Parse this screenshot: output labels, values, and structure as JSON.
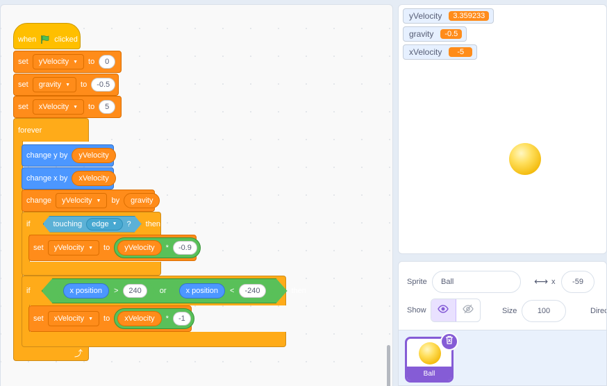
{
  "script": {
    "hat": {
      "when": "when",
      "clicked": "clicked"
    },
    "set1": {
      "kw": "set",
      "var": "yVelocity",
      "to": "to",
      "value": "0"
    },
    "set2": {
      "kw": "set",
      "var": "gravity",
      "to": "to",
      "value": "-0.5"
    },
    "set3": {
      "kw": "set",
      "var": "xVelocity",
      "to": "to",
      "value": "5"
    },
    "forever": "forever",
    "changeY": {
      "label": "change y by",
      "reporter": "yVelocity"
    },
    "changeX": {
      "label": "change x by",
      "reporter": "xVelocity"
    },
    "changeVar": {
      "kw": "change",
      "var": "yVelocity",
      "by": "by",
      "reporter": "gravity"
    },
    "if1": {
      "kw": "if",
      "touching": "touching",
      "target": "edge",
      "q": "?",
      "then": "then"
    },
    "setInner1": {
      "kw": "set",
      "var": "yVelocity",
      "to": "to",
      "reporter": "yVelocity",
      "op": "*",
      "value": "-0.9"
    },
    "if2": {
      "kw": "if",
      "left_reporter": "x position",
      "gt": ">",
      "left_value": "240",
      "or": "or",
      "right_reporter": "x position",
      "lt": "<",
      "right_value": "-240",
      "then": "then"
    },
    "setInner2": {
      "kw": "set",
      "var": "xVelocity",
      "to": "to",
      "reporter": "xVelocity",
      "op": "*",
      "value": "-1"
    }
  },
  "monitors": [
    {
      "name": "yVelocity",
      "value": "3.359233"
    },
    {
      "name": "gravity",
      "value": "-0.5"
    },
    {
      "name": "xVelocity",
      "value": "-5"
    }
  ],
  "sprite_info": {
    "sprite_label": "Sprite",
    "sprite_name": "Ball",
    "x_label": "x",
    "x_value": "-59",
    "show_label": "Show",
    "size_label": "Size",
    "size_value": "100",
    "direction_label": "Direc"
  },
  "sprites": [
    {
      "name": "Ball"
    }
  ],
  "colors": {
    "events": "#ffbf00",
    "variables": "#ff8c1a",
    "control": "#ffab19",
    "motion": "#4c97ff",
    "operators": "#59c059",
    "sensing": "#5cb1d6",
    "selection": "#855cd6"
  }
}
